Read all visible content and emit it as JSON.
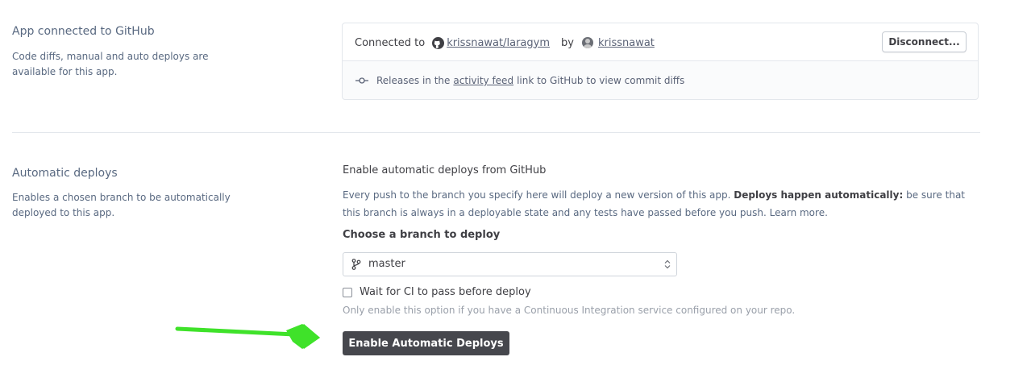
{
  "github": {
    "title": "App connected to GitHub",
    "description": "Code diffs, manual and auto deploys are available for this app.",
    "connected_to_label": "Connected to",
    "repo": "krissnawat/laragym",
    "by_label": "by",
    "user": "krissnawat",
    "disconnect_label": "Disconnect...",
    "releases_prefix": "Releases in the",
    "activity_feed_link": "activity feed",
    "releases_suffix": "link to GitHub to view commit diffs"
  },
  "auto_deploys": {
    "title": "Automatic deploys",
    "description": "Enables a chosen branch to be automatically deployed to this app.",
    "heading": "Enable automatic deploys from GitHub",
    "info_part1": "Every push to the branch you specify here will deploy a new version of this app.",
    "info_bold": "Deploys happen automatically:",
    "info_part2": "be sure that this branch is always in a deployable state and any tests have passed before you push.",
    "learn_more": "Learn more.",
    "branch_label": "Choose a branch to deploy",
    "branch_value": "master",
    "ci_label": "Wait for CI to pass before deploy",
    "ci_checked": false,
    "ci_help": "Only enable this option if you have a Continuous Integration service configured on your repo.",
    "enable_button": "Enable Automatic Deploys"
  },
  "annotation": {
    "arrow_color": "#3fe22a",
    "icon": "arrow-right-icon"
  }
}
